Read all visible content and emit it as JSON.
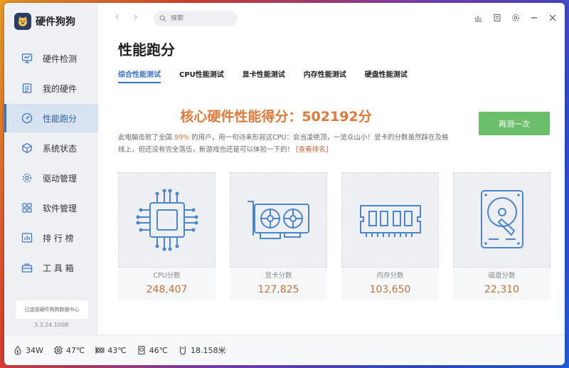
{
  "app": {
    "name": "硬件狗狗"
  },
  "sidebar": {
    "items": [
      {
        "label": "硬件检测",
        "icon": "monitor-icon"
      },
      {
        "label": "我的硬件",
        "icon": "clipboard-icon"
      },
      {
        "label": "性能跑分",
        "icon": "speedometer-icon",
        "active": true
      },
      {
        "label": "系统状态",
        "icon": "cube-icon"
      },
      {
        "label": "驱动管理",
        "icon": "gear-icon"
      },
      {
        "label": "软件管理",
        "icon": "apps-icon"
      },
      {
        "label": "排 行 榜",
        "icon": "chart-icon"
      },
      {
        "label": "工 具 箱",
        "icon": "toolbox-icon"
      }
    ],
    "sync_text": "已连接硬件狗狗数据中心",
    "version": "3.3.24.1008"
  },
  "topbar": {
    "search_placeholder": "搜索"
  },
  "page": {
    "title": "性能跑分",
    "tabs": [
      {
        "label": "综合性能测试",
        "active": true
      },
      {
        "label": "CPU性能测试"
      },
      {
        "label": "显卡性能测试"
      },
      {
        "label": "内存性能测试"
      },
      {
        "label": "硬盘性能测试"
      }
    ],
    "score_headline": "核心硬件性能得分：502192分",
    "desc_part1": "此电脑击败了全国 ",
    "desc_pct": "99%",
    "desc_part2": " 的用户，用一句诗来形容这CPU：会当凌绝顶，一览众山小！显卡的分数虽然踩在及格线上，但还没有完全落伍，新游戏也还是可以体验一下的！",
    "desc_link": "[查看排名]",
    "retest_label": "再测一次"
  },
  "cards": [
    {
      "label": "CPU分数",
      "value": "248,407",
      "icon": "cpu-chip-icon"
    },
    {
      "label": "显卡分数",
      "value": "127,825",
      "icon": "graphics-card-icon"
    },
    {
      "label": "内存分数",
      "value": "103,650",
      "icon": "memory-module-icon"
    },
    {
      "label": "磁盘分数",
      "value": "22,310",
      "icon": "hard-disk-icon"
    }
  ],
  "status": {
    "power": "34W",
    "cpu_temp": "47℃",
    "gpu_temp": "43℃",
    "disk_temp": "46℃",
    "fan": "18.158米"
  },
  "colors": {
    "accent": "#3a74c8",
    "score": "#e07a3b",
    "retest": "#6cbf6a",
    "icon_blue": "#4a86cc"
  }
}
